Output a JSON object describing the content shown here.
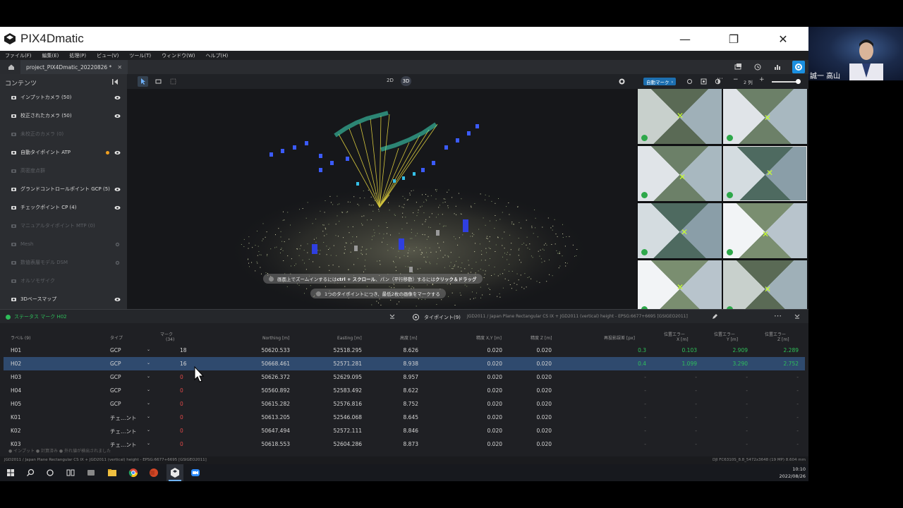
{
  "window": {
    "app_title": "PIX4Dmatic",
    "minimize": "—",
    "restore": "❐",
    "close": "✕"
  },
  "webcam": {
    "name": "誠一 高山"
  },
  "menu": [
    "ファイル(F)",
    "編集(E)",
    "処理(P)",
    "ビュー(V)",
    "ツール(T)",
    "ウィンドウ(W)",
    "ヘルプ(H)"
  ],
  "tab": {
    "project": "project_PIX4Dmatic_20220826 *",
    "close": "✕"
  },
  "left_panel": {
    "title": "コンテンツ",
    "items": [
      {
        "label": "インプットカメラ (50)",
        "dim": false,
        "eye": true,
        "icon": "camera-icon"
      },
      {
        "label": "校正されたカメラ (50)",
        "dim": false,
        "eye": true,
        "icon": "calibrated-camera-icon"
      },
      {
        "label": "未校正のカメラ (0)",
        "dim": true,
        "eye": false,
        "icon": "uncalibrated-camera-icon"
      },
      {
        "label": "自動タイポイント ATP",
        "dim": false,
        "eye": true,
        "icon": "tiepoint-icon",
        "dot": true
      },
      {
        "label": "高密度点群",
        "dim": true,
        "eye": false,
        "icon": "point-cloud-icon"
      },
      {
        "label": "グランドコントロールポイント GCP (5)",
        "dim": false,
        "eye": true,
        "icon": "gcp-icon"
      },
      {
        "label": "チェックポイント CP (4)",
        "dim": false,
        "eye": true,
        "icon": "checkpoint-icon"
      },
      {
        "label": "マニュアルタイポイント MTP (0)",
        "dim": true,
        "eye": false,
        "icon": "mtp-icon"
      },
      {
        "label": "Mesh",
        "dim": true,
        "eye": false,
        "icon": "mesh-icon",
        "gear": true
      },
      {
        "label": "数値表層モデル DSM",
        "dim": true,
        "eye": false,
        "icon": "dsm-icon",
        "gear": true
      },
      {
        "label": "オルソモザイク",
        "dim": true,
        "eye": false,
        "icon": "ortho-icon"
      },
      {
        "label": "3Dベースマップ",
        "dim": false,
        "eye": true,
        "icon": "basemap-icon"
      }
    ]
  },
  "viewport": {
    "mode_2d": "2D",
    "mode_3d": "3D",
    "hint1_a": "画面上でズームインするには",
    "hint1_b": "ctrl + スクロール",
    "hint1_c": "、パン（平行移動）するには",
    "hint1_d": "クリック＆ドラッグ",
    "hint2": "1つのタイポイントにつき、最低2枚の画像をマークする"
  },
  "image_panel": {
    "auto_mark": "自動マーク",
    "columns": "2 列",
    "minus": "−",
    "plus": "+"
  },
  "status": {
    "label": "ステータス マーク H02",
    "tiepoint_label": "タイポイント(9)",
    "crs": "JGD2011 / Japan Plane Rectangular CS IX + JGD2011 (vertical) height - EPSG:6677+6695 [GSIGEO2011]"
  },
  "table": {
    "headers": {
      "label": "ラベル (9)",
      "type": "タイプ",
      "mark": "マーク",
      "mark_sub": "(34)",
      "northing": "Northing [m]",
      "easting": "Easting [m]",
      "altitude": "高度 [m]",
      "acc_xy": "精度 X,Y [m]",
      "acc_z": "精度 Z [m]",
      "reproj": "再投影誤差 [px]",
      "err_x": "位置エラー",
      "err_x_sub": "X [m]",
      "err_y": "位置エラー",
      "err_y_sub": "Y [m]",
      "err_z": "位置エラー",
      "err_z_sub": "Z [m]"
    },
    "rows": [
      {
        "label": "H01",
        "type": "GCP",
        "mark": "18",
        "northing": "50620.533",
        "easting": "52518.295",
        "alt": "8.626",
        "accxy": "0.020",
        "accz": "0.020",
        "reproj": "0.3",
        "ex": "0.103",
        "ey": "2.909",
        "ez": "2.289",
        "selected": false,
        "marked": true
      },
      {
        "label": "H02",
        "type": "GCP",
        "mark": "16",
        "northing": "50668.461",
        "easting": "52571.281",
        "alt": "8.938",
        "accxy": "0.020",
        "accz": "0.020",
        "reproj": "0.4",
        "ex": "1.099",
        "ey": "3.290",
        "ez": "2.752",
        "selected": true,
        "marked": true
      },
      {
        "label": "H03",
        "type": "GCP",
        "mark": "0",
        "northing": "50626.372",
        "easting": "52629.095",
        "alt": "8.957",
        "accxy": "0.020",
        "accz": "0.020",
        "reproj": "-",
        "ex": "-",
        "ey": "-",
        "ez": "-",
        "selected": false,
        "marked": false
      },
      {
        "label": "H04",
        "type": "GCP",
        "mark": "0",
        "northing": "50560.892",
        "easting": "52583.492",
        "alt": "8.622",
        "accxy": "0.020",
        "accz": "0.020",
        "reproj": "-",
        "ex": "-",
        "ey": "-",
        "ez": "-",
        "selected": false,
        "marked": false
      },
      {
        "label": "H05",
        "type": "GCP",
        "mark": "0",
        "northing": "50615.282",
        "easting": "52576.816",
        "alt": "8.752",
        "accxy": "0.020",
        "accz": "0.020",
        "reproj": "-",
        "ex": "-",
        "ey": "-",
        "ez": "-",
        "selected": false,
        "marked": false
      },
      {
        "label": "K01",
        "type": "チェ…ント",
        "mark": "0",
        "northing": "50613.205",
        "easting": "52546.068",
        "alt": "8.645",
        "accxy": "0.020",
        "accz": "0.020",
        "reproj": "-",
        "ex": "-",
        "ey": "-",
        "ez": "-",
        "selected": false,
        "marked": false
      },
      {
        "label": "K02",
        "type": "チェ…ント",
        "mark": "0",
        "northing": "50647.494",
        "easting": "52572.111",
        "alt": "8.846",
        "accxy": "0.020",
        "accz": "0.020",
        "reproj": "-",
        "ex": "-",
        "ey": "-",
        "ez": "-",
        "selected": false,
        "marked": false
      },
      {
        "label": "K03",
        "type": "チェ…ント",
        "mark": "0",
        "northing": "50618.553",
        "easting": "52604.286",
        "alt": "8.873",
        "accxy": "0.020",
        "accz": "0.020",
        "reproj": "-",
        "ex": "-",
        "ey": "-",
        "ez": "-",
        "selected": false,
        "marked": false
      }
    ],
    "legend": "● インプット   ● 計算済み   ● 外れ値が検出されました"
  },
  "bottom_bar": {
    "crs": "JGD2011 / Japan Plane Rectangular CS IX + JGD2011 (vertical) height - EPSG:6677+6695 [GSIGEO2011]",
    "camera": "DJI FC6310S_8.8_5472x3648 (19 MP)  8.604 mm"
  },
  "taskbar": {
    "time": "10:10",
    "date": "2022/08/26"
  },
  "colors": {
    "accent": "#1a8fe0",
    "selected_row": "#2f4a6e",
    "ok_green": "#2ec05a",
    "zero_red": "#e04848"
  }
}
